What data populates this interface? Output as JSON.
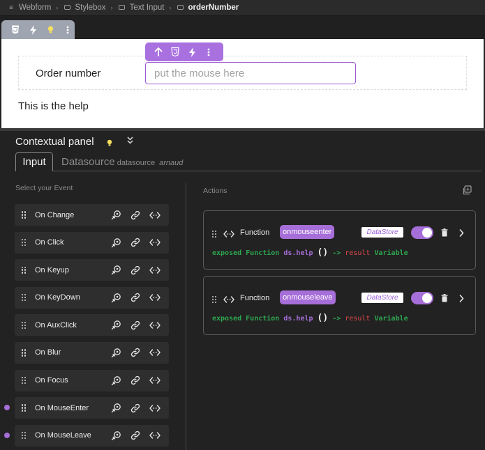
{
  "breadcrumb": {
    "items": [
      {
        "label": "Webform",
        "icon": "menu-icon"
      },
      {
        "label": "Stylebox",
        "icon": "stylebox-icon"
      },
      {
        "label": "Text Input",
        "icon": "text-input-icon"
      },
      {
        "label": "orderNumber",
        "icon": "input-field-icon"
      }
    ]
  },
  "element_toolbar": {
    "icons": [
      "css-icon",
      "lightning-icon",
      "bulb-icon",
      "more-vertical-icon"
    ]
  },
  "canvas": {
    "field_label": "Order number",
    "input_placeholder": "put the mouse here",
    "help_text": "This is the help"
  },
  "input_toolbar": {
    "icons": [
      "arrow-up-icon",
      "css-icon",
      "lightning-icon",
      "more-vertical-icon"
    ]
  },
  "panel": {
    "title": "Contextual panel",
    "tabs": {
      "input": "Input",
      "datasource": "Datasource",
      "datasource_small": "datasource",
      "datasource_user": "arnaud"
    },
    "select_event_label": "Select your Event",
    "actions_label": "Actions"
  },
  "events": [
    {
      "label": "On Change",
      "active": false
    },
    {
      "label": "On Click",
      "active": false
    },
    {
      "label": "On Keyup",
      "active": false
    },
    {
      "label": "On KeyDown",
      "active": false
    },
    {
      "label": "On AuxClick",
      "active": false
    },
    {
      "label": "On Blur",
      "active": false
    },
    {
      "label": "On Focus",
      "active": false
    },
    {
      "label": "On MouseEnter",
      "active": true
    },
    {
      "label": "On MouseLeave",
      "active": true
    }
  ],
  "actions": [
    {
      "type_label": "Function",
      "function_name": "onmouseenter",
      "datastore_tag": "DataStore",
      "enabled": true,
      "code": {
        "exposed": "exposed Function",
        "name": "ds.help",
        "parens": "()",
        "arrow": "->",
        "result": "result",
        "var": "Variable"
      }
    },
    {
      "type_label": "Function",
      "function_name": "onmouseleave",
      "datastore_tag": "DataStore",
      "enabled": true,
      "code": {
        "exposed": "exposed Function",
        "name": "ds.help",
        "parens": "()",
        "arrow": "->",
        "result": "result",
        "var": "Variable"
      }
    }
  ],
  "colors": {
    "accent": "#a66ed8",
    "background": "#222222",
    "code_green": "#2ea54f",
    "code_red": "#e0484a"
  }
}
